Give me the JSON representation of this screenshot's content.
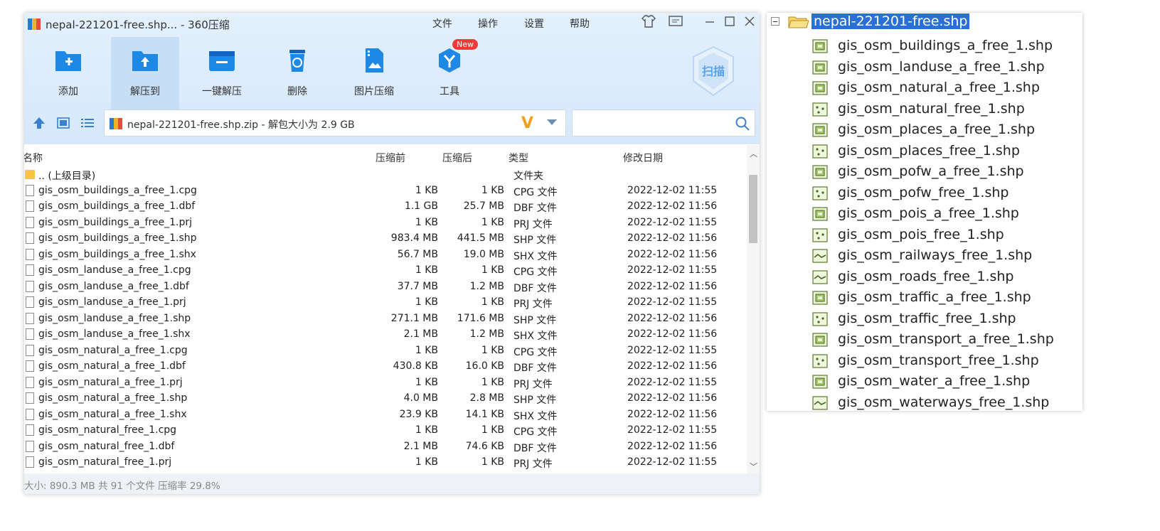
{
  "window": {
    "title": "nepal-221201-free.shp... - 360压缩",
    "menu": [
      "文件",
      "操作",
      "设置",
      "帮助"
    ]
  },
  "toolbar": {
    "items": [
      {
        "label": "添加",
        "icon": "add-folder-icon"
      },
      {
        "label": "解压到",
        "icon": "extract-to-icon"
      },
      {
        "label": "一键解压",
        "icon": "one-click-extract-icon"
      },
      {
        "label": "删除",
        "icon": "delete-icon"
      },
      {
        "label": "图片压缩",
        "icon": "image-compress-icon"
      },
      {
        "label": "工具",
        "icon": "tools-icon"
      }
    ],
    "new_badge": "New",
    "scan_label": "扫描"
  },
  "address": {
    "path": "nepal-221201-free.shp.zip - 解包大小为 2.9 GB",
    "v_label": "V"
  },
  "columns": {
    "name": "名称",
    "before": "压缩前",
    "after": "压缩后",
    "type": "类型",
    "date": "修改日期"
  },
  "rows": [
    {
      "name": ".. (上级目录)",
      "before": "",
      "after": "",
      "type": "文件夹",
      "date": ""
    },
    {
      "name": "gis_osm_buildings_a_free_1.cpg",
      "before": "1 KB",
      "after": "1 KB",
      "type": "CPG 文件",
      "date": "2022-12-02 11:55"
    },
    {
      "name": "gis_osm_buildings_a_free_1.dbf",
      "before": "1.1 GB",
      "after": "25.7 MB",
      "type": "DBF 文件",
      "date": "2022-12-02 11:56"
    },
    {
      "name": "gis_osm_buildings_a_free_1.prj",
      "before": "1 KB",
      "after": "1 KB",
      "type": "PRJ 文件",
      "date": "2022-12-02 11:55"
    },
    {
      "name": "gis_osm_buildings_a_free_1.shp",
      "before": "983.4 MB",
      "after": "441.5 MB",
      "type": "SHP 文件",
      "date": "2022-12-02 11:56"
    },
    {
      "name": "gis_osm_buildings_a_free_1.shx",
      "before": "56.7 MB",
      "after": "19.0 MB",
      "type": "SHX 文件",
      "date": "2022-12-02 11:56"
    },
    {
      "name": "gis_osm_landuse_a_free_1.cpg",
      "before": "1 KB",
      "after": "1 KB",
      "type": "CPG 文件",
      "date": "2022-12-02 11:55"
    },
    {
      "name": "gis_osm_landuse_a_free_1.dbf",
      "before": "37.7 MB",
      "after": "1.2 MB",
      "type": "DBF 文件",
      "date": "2022-12-02 11:56"
    },
    {
      "name": "gis_osm_landuse_a_free_1.prj",
      "before": "1 KB",
      "after": "1 KB",
      "type": "PRJ 文件",
      "date": "2022-12-02 11:55"
    },
    {
      "name": "gis_osm_landuse_a_free_1.shp",
      "before": "271.1 MB",
      "after": "171.6 MB",
      "type": "SHP 文件",
      "date": "2022-12-02 11:56"
    },
    {
      "name": "gis_osm_landuse_a_free_1.shx",
      "before": "2.1 MB",
      "after": "1.2 MB",
      "type": "SHX 文件",
      "date": "2022-12-02 11:56"
    },
    {
      "name": "gis_osm_natural_a_free_1.cpg",
      "before": "1 KB",
      "after": "1 KB",
      "type": "CPG 文件",
      "date": "2022-12-02 11:55"
    },
    {
      "name": "gis_osm_natural_a_free_1.dbf",
      "before": "430.8 KB",
      "after": "16.0 KB",
      "type": "DBF 文件",
      "date": "2022-12-02 11:56"
    },
    {
      "name": "gis_osm_natural_a_free_1.prj",
      "before": "1 KB",
      "after": "1 KB",
      "type": "PRJ 文件",
      "date": "2022-12-02 11:55"
    },
    {
      "name": "gis_osm_natural_a_free_1.shp",
      "before": "4.0 MB",
      "after": "2.8 MB",
      "type": "SHP 文件",
      "date": "2022-12-02 11:56"
    },
    {
      "name": "gis_osm_natural_a_free_1.shx",
      "before": "23.9 KB",
      "after": "14.1 KB",
      "type": "SHX 文件",
      "date": "2022-12-02 11:56"
    },
    {
      "name": "gis_osm_natural_free_1.cpg",
      "before": "1 KB",
      "after": "1 KB",
      "type": "CPG 文件",
      "date": "2022-12-02 11:55"
    },
    {
      "name": "gis_osm_natural_free_1.dbf",
      "before": "2.1 MB",
      "after": "74.6 KB",
      "type": "DBF 文件",
      "date": "2022-12-02 11:56"
    },
    {
      "name": "gis_osm_natural_free_1.prj",
      "before": "1 KB",
      "after": "1 KB",
      "type": "PRJ 文件",
      "date": "2022-12-02 11:55"
    }
  ],
  "status": "大小: 890.3 MB 共 91 个文件 压缩率 29.8%",
  "tree": {
    "root": "nepal-221201-free.shp",
    "items": [
      {
        "name": "gis_osm_buildings_a_free_1.shp",
        "icon": "polygon-layer-icon"
      },
      {
        "name": "gis_osm_landuse_a_free_1.shp",
        "icon": "polygon-layer-icon"
      },
      {
        "name": "gis_osm_natural_a_free_1.shp",
        "icon": "polygon-layer-icon"
      },
      {
        "name": "gis_osm_natural_free_1.shp",
        "icon": "point-layer-icon"
      },
      {
        "name": "gis_osm_places_a_free_1.shp",
        "icon": "polygon-layer-icon"
      },
      {
        "name": "gis_osm_places_free_1.shp",
        "icon": "point-layer-icon"
      },
      {
        "name": "gis_osm_pofw_a_free_1.shp",
        "icon": "polygon-layer-icon"
      },
      {
        "name": "gis_osm_pofw_free_1.shp",
        "icon": "point-layer-icon"
      },
      {
        "name": "gis_osm_pois_a_free_1.shp",
        "icon": "polygon-layer-icon"
      },
      {
        "name": "gis_osm_pois_free_1.shp",
        "icon": "point-layer-icon"
      },
      {
        "name": "gis_osm_railways_free_1.shp",
        "icon": "line-layer-icon"
      },
      {
        "name": "gis_osm_roads_free_1.shp",
        "icon": "line-layer-icon"
      },
      {
        "name": "gis_osm_traffic_a_free_1.shp",
        "icon": "polygon-layer-icon"
      },
      {
        "name": "gis_osm_traffic_free_1.shp",
        "icon": "point-layer-icon"
      },
      {
        "name": "gis_osm_transport_a_free_1.shp",
        "icon": "polygon-layer-icon"
      },
      {
        "name": "gis_osm_transport_free_1.shp",
        "icon": "point-layer-icon"
      },
      {
        "name": "gis_osm_water_a_free_1.shp",
        "icon": "polygon-layer-icon"
      },
      {
        "name": "gis_osm_waterways_free_1.shp",
        "icon": "line-layer-icon"
      }
    ]
  },
  "colors": {
    "accent": "#2a6fd6",
    "toolbar_bg": "#d6e8fb",
    "icon_blue": "#1e88e5"
  }
}
